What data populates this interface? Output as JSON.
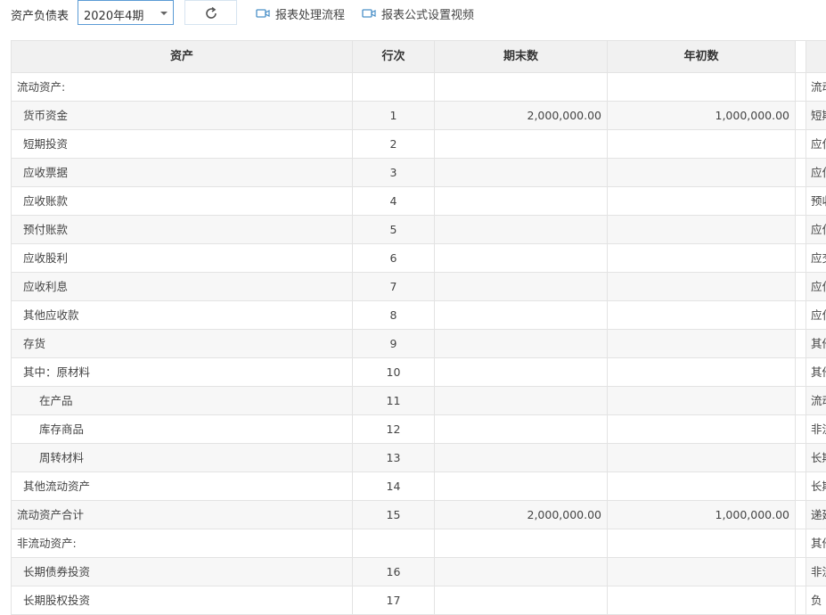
{
  "toolbar": {
    "report_label": "资产负债表",
    "period_value": "2020年4期",
    "refresh_icon": "refresh-icon",
    "link_process": "报表处理流程",
    "link_formula_video": "报表公式设置视频",
    "video_icon": "video-camera-icon",
    "accent_color": "#5b9bd5"
  },
  "table": {
    "headers": {
      "asset": "资产",
      "line_no": "行次",
      "end_amount": "期末数",
      "begin_amount": "年初数"
    },
    "rows": [
      {
        "asset": "流动资产:",
        "indent": 0,
        "line": "",
        "end": "",
        "begin": "",
        "liab": "流动负"
      },
      {
        "asset": "货币资金",
        "indent": 1,
        "line": "1",
        "end": "2,000,000.00",
        "begin": "1,000,000.00",
        "liab": "短期"
      },
      {
        "asset": "短期投资",
        "indent": 1,
        "line": "2",
        "end": "",
        "begin": "",
        "liab": "应付"
      },
      {
        "asset": "应收票据",
        "indent": 1,
        "line": "3",
        "end": "",
        "begin": "",
        "liab": "应付"
      },
      {
        "asset": "应收账款",
        "indent": 1,
        "line": "4",
        "end": "",
        "begin": "",
        "liab": "预收"
      },
      {
        "asset": "预付账款",
        "indent": 1,
        "line": "5",
        "end": "",
        "begin": "",
        "liab": "应付"
      },
      {
        "asset": "应收股利",
        "indent": 1,
        "line": "6",
        "end": "",
        "begin": "",
        "liab": "应交"
      },
      {
        "asset": "应收利息",
        "indent": 1,
        "line": "7",
        "end": "",
        "begin": "",
        "liab": "应付"
      },
      {
        "asset": "其他应收款",
        "indent": 1,
        "line": "8",
        "end": "",
        "begin": "",
        "liab": "应付"
      },
      {
        "asset": "存货",
        "indent": 1,
        "line": "9",
        "end": "",
        "begin": "",
        "liab": "其他"
      },
      {
        "asset": "其中：原材料",
        "indent": 1,
        "line": "10",
        "end": "",
        "begin": "",
        "liab": "其他"
      },
      {
        "asset": "在产品",
        "indent": 2,
        "line": "11",
        "end": "",
        "begin": "",
        "liab": "流动"
      },
      {
        "asset": "库存商品",
        "indent": 2,
        "line": "12",
        "end": "",
        "begin": "",
        "liab": "非流动"
      },
      {
        "asset": "周转材料",
        "indent": 2,
        "line": "13",
        "end": "",
        "begin": "",
        "liab": "长期"
      },
      {
        "asset": "其他流动资产",
        "indent": 1,
        "line": "14",
        "end": "",
        "begin": "",
        "liab": "长期"
      },
      {
        "asset": "流动资产合计",
        "indent": 0,
        "line": "15",
        "end": "2,000,000.00",
        "begin": "1,000,000.00",
        "liab": "递延"
      },
      {
        "asset": "非流动资产:",
        "indent": 0,
        "line": "",
        "end": "",
        "begin": "",
        "liab": "其他"
      },
      {
        "asset": "长期债券投资",
        "indent": 1,
        "line": "16",
        "end": "",
        "begin": "",
        "liab": "非流"
      },
      {
        "asset": "长期股权投资",
        "indent": 1,
        "line": "17",
        "end": "",
        "begin": "",
        "liab": "负"
      }
    ]
  }
}
